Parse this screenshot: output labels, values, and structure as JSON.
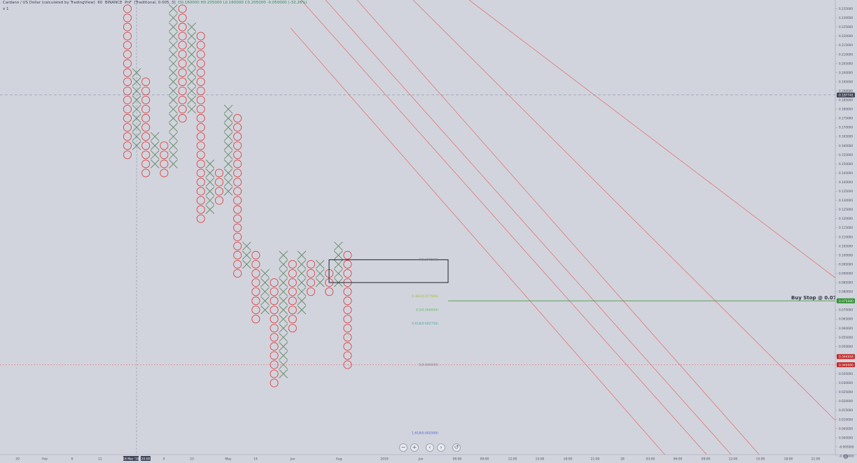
{
  "header": {
    "title": "Cardano / US Dollar (calculated by TradingView)",
    "interval": "60",
    "exchange": "BINANCE",
    "chart_type": "PnF",
    "params": "[Traditional, 0.005, 3]",
    "ohlc": "O0.160000 H0.205000 L0.160000 C0.205000 -0.050000 (-32.26%)",
    "sub_indicator": "x 1"
  },
  "colors": {
    "background": "#d2d4dd",
    "x_color": "#6b8f6e",
    "o_color": "#d94a4a",
    "trendline": "#e07575",
    "buy_stop": "#2f8f2f",
    "price_label": "#3f4456",
    "low_label": "#c62828"
  },
  "controls": [
    "−",
    "+",
    "‹",
    "›",
    "↺"
  ],
  "settings_icon": "gear-icon",
  "chart_data": {
    "type": "pnf",
    "symbol": "ADAUSD",
    "box_size": 0.005,
    "reversal": 3,
    "ylim": [
      -0.025,
      0.255
    ],
    "y_ticks": [
      "0.235000",
      "0.230000",
      "0.225000",
      "0.220000",
      "0.215000",
      "0.210000",
      "0.205000",
      "0.200000",
      "0.195000",
      "0.190000",
      "0.185000",
      "0.180000",
      "0.175000",
      "0.170000",
      "0.165000",
      "0.160000",
      "0.155000",
      "0.150000",
      "0.145000",
      "0.140000",
      "0.135000",
      "0.130000",
      "0.125000",
      "0.120000",
      "0.115000",
      "0.110000",
      "0.105000",
      "0.100000",
      "0.095000",
      "0.090000",
      "0.085000",
      "0.080000",
      "0.075000",
      "0.070000",
      "0.065000",
      "0.060000",
      "0.055000",
      "0.050000",
      "0.045000",
      "0.040000",
      "0.035000",
      "0.030000",
      "0.025000",
      "0.020000",
      "0.015000",
      "0.010000",
      "0.005000",
      "0.000000",
      "-0.005000",
      "-0.010000",
      "-0.015000",
      "-0.020000"
    ],
    "x_ticks": [
      "20",
      "Feb",
      "6",
      "11",
      "18 Mar '18",
      "20:00",
      "4",
      "23",
      "May",
      "14",
      "Jun",
      "Aug",
      "2019",
      "Jun",
      "06:00",
      "09:00",
      "12:00",
      "15:00",
      "18:00",
      "21:00",
      "28",
      "03:00",
      "06:00",
      "09:00",
      "12:00",
      "15:00",
      "18:00",
      "21:00"
    ],
    "columns": [
      {
        "type": "O",
        "high": 0.235,
        "low": 0.155
      },
      {
        "type": "X",
        "high": 0.2,
        "low": 0.16
      },
      {
        "type": "O",
        "high": 0.195,
        "low": 0.145
      },
      {
        "type": "X",
        "high": 0.165,
        "low": 0.15
      },
      {
        "type": "O",
        "high": 0.16,
        "low": 0.145
      },
      {
        "type": "X",
        "high": 0.235,
        "low": 0.15
      },
      {
        "type": "O",
        "high": 0.235,
        "low": 0.175
      },
      {
        "type": "X",
        "high": 0.225,
        "low": 0.18
      },
      {
        "type": "O",
        "high": 0.22,
        "low": 0.12
      },
      {
        "type": "X",
        "high": 0.15,
        "low": 0.125
      },
      {
        "type": "O",
        "high": 0.145,
        "low": 0.13
      },
      {
        "type": "X",
        "high": 0.18,
        "low": 0.135
      },
      {
        "type": "O",
        "high": 0.175,
        "low": 0.09
      },
      {
        "type": "X",
        "high": 0.105,
        "low": 0.095
      },
      {
        "type": "O",
        "high": 0.1,
        "low": 0.065
      },
      {
        "type": "X",
        "high": 0.09,
        "low": 0.07
      },
      {
        "type": "O",
        "high": 0.085,
        "low": 0.03
      },
      {
        "type": "X",
        "high": 0.1,
        "low": 0.035
      },
      {
        "type": "O",
        "high": 0.095,
        "low": 0.06
      },
      {
        "type": "X",
        "high": 0.1,
        "low": 0.07
      },
      {
        "type": "O",
        "high": 0.095,
        "low": 0.08
      },
      {
        "type": "X",
        "high": 0.095,
        "low": 0.085
      },
      {
        "type": "O",
        "high": 0.09,
        "low": 0.08
      },
      {
        "type": "X",
        "high": 0.105,
        "low": 0.085
      },
      {
        "type": "O",
        "high": 0.1,
        "low": 0.04
      }
    ],
    "current_price_label": "0.187741",
    "current_price": 0.187741,
    "buy_stop_label": "Buy Stop @ 0.075",
    "buy_stop_price": 0.075,
    "buy_stop_tag": "0.075000",
    "low_tags": [
      {
        "label": "0.044444",
        "value": 0.044444
      },
      {
        "label": "0.040000",
        "value": 0.04
      }
    ],
    "range_box": {
      "top": 0.0975,
      "bottom": 0.085
    },
    "fib_labels": [
      {
        "text": "0(0.097500)",
        "value": 0.097,
        "color": "#7a7f8f"
      },
      {
        "text": "0.382(0.077500)",
        "value": 0.077,
        "color": "#a3b93a"
      },
      {
        "text": "0.5(0.069000)",
        "value": 0.0695,
        "color": "#5fb85f"
      },
      {
        "text": "0.618(0.062750)",
        "value": 0.062,
        "color": "#3fa8a0"
      },
      {
        "text": "1(0.040000)",
        "value": 0.0395,
        "color": "#7a7f8f"
      },
      {
        "text": "1.618(0.002500)",
        "value": 0.002,
        "color": "#4b5fd0"
      }
    ]
  }
}
